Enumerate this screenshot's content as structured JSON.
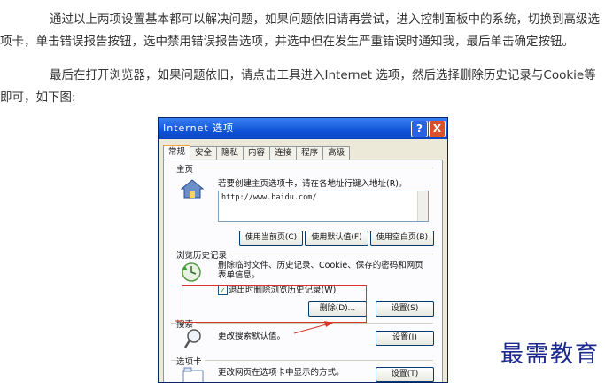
{
  "article": {
    "p1_line1": "通过以上两项设置基本都可以解决问题，如果问题依旧请再尝试，进入控制面板中的系统，切换到高级选",
    "p1_line2": "项卡，单击错误报告按钮，选中禁用错误报告选项，并选中但在发生严重错误时通知我，最后单击确定按钮。",
    "p2_line1": "最后在打开浏览器，如果问题依旧，请点击工具进入Internet 选项，然后选择删除历史记录与Cookie等",
    "p2_line2": "即可，如下图:"
  },
  "dialog": {
    "title": "Internet 选项",
    "help_glyph": "?",
    "close_glyph": "X",
    "tabs": [
      "常规",
      "安全",
      "隐私",
      "内容",
      "连接",
      "程序",
      "高级"
    ],
    "homepage": {
      "group_label": "主页",
      "desc": "若要创建主页选项卡，请在各地址行键入地址(R)。",
      "url": "http://www.baidu.com/",
      "btn_current": "使用当前页(C)",
      "btn_default": "使用默认值(F)",
      "btn_blank": "使用空白页(B)"
    },
    "history": {
      "group_label": "浏览历史记录",
      "desc_line1": "删除临时文件、历史记录、Cookie、保存的密码和网页",
      "desc_line2": "表单信息。",
      "checkbox_label": "退出时删除浏览历史记录(W)",
      "checkbox_checked": true,
      "btn_delete": "删除(D)...",
      "btn_settings": "设置(S)"
    },
    "search": {
      "group_label": "搜索",
      "desc": "更改搜索默认值。",
      "btn_settings": "设置(I)"
    },
    "tabs_section": {
      "group_label": "选项卡",
      "desc": "更改网页在选项卡中显示的方式。",
      "btn_settings": "设置(T)"
    }
  },
  "annotation_color": "#d9342b",
  "watermark": "最需教育"
}
